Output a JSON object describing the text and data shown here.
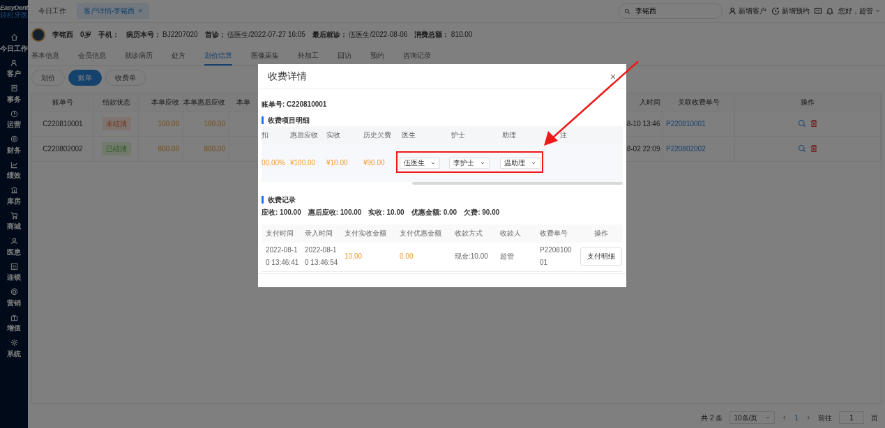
{
  "sidebar": {
    "brand": "EasyDent",
    "subtitle": "轻松牙医",
    "items": [
      {
        "label": "今日工作"
      },
      {
        "label": "客户"
      },
      {
        "label": "事务"
      },
      {
        "label": "运营"
      },
      {
        "label": "财务"
      },
      {
        "label": "绩效"
      },
      {
        "label": "库房"
      },
      {
        "label": "商城"
      },
      {
        "label": "医患"
      },
      {
        "label": "连锁"
      },
      {
        "label": "营销"
      },
      {
        "label": "增值"
      },
      {
        "label": "系统"
      }
    ]
  },
  "top_tabs": [
    {
      "label": "今日工作",
      "selected": false
    },
    {
      "label": "客户详情-李铭西",
      "selected": true,
      "close": "×"
    }
  ],
  "search": {
    "value": "李铭西"
  },
  "header_actions": [
    {
      "label": "新增客户"
    },
    {
      "label": "新增预约"
    }
  ],
  "user_menu": {
    "label": "您好，超管"
  },
  "patient": {
    "name": "李铭西",
    "age": "0岁",
    "fields": [
      {
        "label": "手机："
      },
      {
        "label": "病历本号：",
        "value": "BJ2207020"
      },
      {
        "label": "首诊：",
        "value": "伍医生/2022-07-27 16:05"
      },
      {
        "label": "最后就诊：",
        "value": "伍医生/2022-08-06"
      },
      {
        "label": "消费总额：",
        "value": "810.00"
      }
    ]
  },
  "sub_tabs": [
    {
      "label": "基本信息",
      "selected": false
    },
    {
      "label": "会员信息",
      "selected": false
    },
    {
      "label": "就诊病历",
      "selected": false
    },
    {
      "label": "处方",
      "selected": false
    },
    {
      "label": "划价结算",
      "selected": true
    },
    {
      "label": "图像采集",
      "selected": false
    },
    {
      "label": "外加工",
      "selected": false
    },
    {
      "label": "回访",
      "selected": false
    },
    {
      "label": "预约",
      "selected": false
    },
    {
      "label": "咨询记录",
      "selected": false
    }
  ],
  "bill_types": [
    {
      "label": "划价",
      "selected": false
    },
    {
      "label": "账单",
      "selected": true
    },
    {
      "label": "收费单",
      "selected": false
    }
  ],
  "bills_table": {
    "columns": [
      "账单号",
      "结款状态",
      "本单应收",
      "本单惠后应收",
      "本单",
      "入时间",
      "关联收费单号",
      "操作"
    ],
    "rows": [
      {
        "bill_no": "C220810001",
        "status": "未结清",
        "settled": false,
        "receivable": "100.00",
        "discounted": "100.00",
        "time": "8-10 13:46",
        "receipt_no": "P220810001"
      },
      {
        "bill_no": "C220802002",
        "status": "已结清",
        "settled": true,
        "receivable": "800.00",
        "discounted": "800.00",
        "time": "8-02 22:09",
        "receipt_no": "P220802002"
      }
    ]
  },
  "pagination": {
    "total": "共 2 条",
    "page_size": "10条/页",
    "current": "1",
    "goto_label": "前往",
    "goto_value": "1",
    "page_suffix": "页"
  },
  "modal": {
    "title": "收费详情",
    "bill_no": "账单号: C220810001",
    "items_section": "收费项目明细",
    "items_table": {
      "columns": [
        "扣",
        "惠后应收",
        "实收",
        "历史欠费",
        "医生",
        "护士",
        "助理",
        "注"
      ],
      "rows": [
        {
          "cells": [
            {
              "kind": "amount",
              "text": "00.00%"
            },
            {
              "kind": "amount",
              "text": "¥100.00"
            },
            {
              "kind": "amount",
              "text": "¥10.00"
            },
            {
              "kind": "amount",
              "text": "¥90.00"
            },
            {
              "kind": "select",
              "text": "伍医生"
            },
            {
              "kind": "select",
              "text": "李护士"
            },
            {
              "kind": "select",
              "text": "温助理"
            }
          ]
        }
      ]
    },
    "records_section": "收费记录",
    "summary": [
      "应收: 100.00",
      "惠后应收: 100.00",
      "实收: 10.00",
      "优惠金额: 0.00",
      "欠费: 90.00"
    ],
    "records_table": {
      "columns": [
        "支付时间",
        "录入时间",
        "支付实收金额",
        "支付优惠金额",
        "收款方式",
        "收款人",
        "收费单号",
        "操作"
      ],
      "rows": [
        {
          "cells": [
            {
              "kind": "text",
              "text": "2022-08-10 13:46:41"
            },
            {
              "kind": "text",
              "text": "2022-08-10 13:46:54"
            },
            {
              "kind": "amount",
              "text": "10.00"
            },
            {
              "kind": "amount",
              "text": "0.00"
            },
            {
              "kind": "text",
              "text": "现金:10.00"
            },
            {
              "kind": "text",
              "text": "超管"
            },
            {
              "kind": "text",
              "text": "P220810001"
            }
          ],
          "action": "支付明细"
        }
      ]
    }
  }
}
